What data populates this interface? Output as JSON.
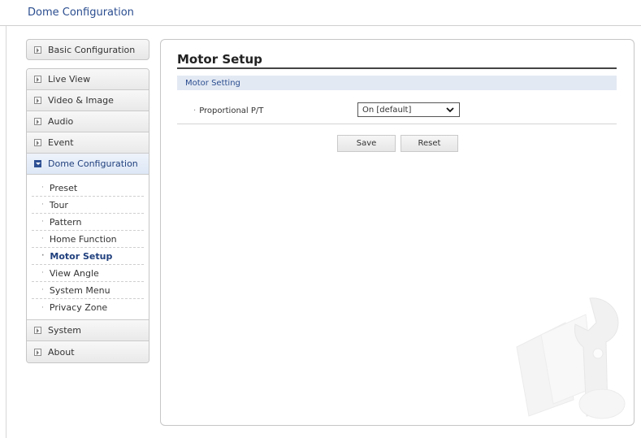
{
  "header": {
    "title": "Dome Configuration"
  },
  "sidebar": {
    "top_item": {
      "label": "Basic Configuration"
    },
    "items": [
      {
        "label": "Live View"
      },
      {
        "label": "Video & Image"
      },
      {
        "label": "Audio"
      },
      {
        "label": "Event"
      },
      {
        "label": "Dome Configuration"
      }
    ],
    "submenu": [
      {
        "label": "Preset"
      },
      {
        "label": "Tour"
      },
      {
        "label": "Pattern"
      },
      {
        "label": "Home Function"
      },
      {
        "label": "Motor Setup"
      },
      {
        "label": "View Angle"
      },
      {
        "label": "System Menu"
      },
      {
        "label": "Privacy Zone"
      }
    ],
    "bottom_items": [
      {
        "label": "System"
      },
      {
        "label": "About"
      }
    ]
  },
  "main": {
    "title": "Motor Setup",
    "section": "Motor Setting",
    "field": {
      "label": "Proportional P/T",
      "value": "On [default]"
    },
    "save_label": "Save",
    "reset_label": "Reset"
  }
}
